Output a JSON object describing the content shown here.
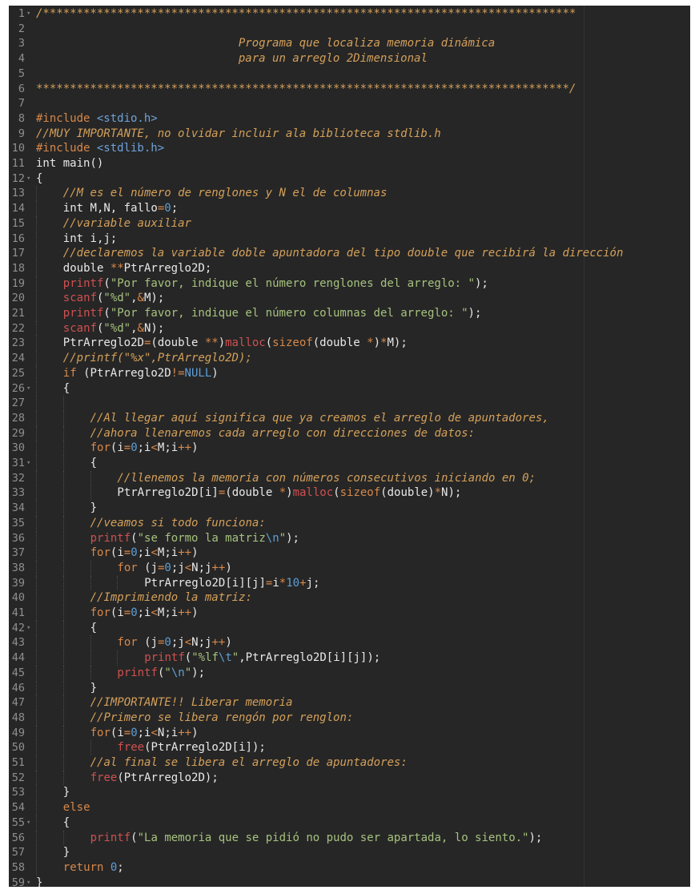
{
  "editor": {
    "line_height": 18.7,
    "char_width": 8.45,
    "colors": {
      "background": "#262626",
      "line_number": "#8f8f8f",
      "comment": "#d4a05a",
      "string": "#a6c27e",
      "keyword": "#d7884a",
      "function": "#cf5050",
      "number": "#5d9fd6",
      "text": "#e8e8e8"
    },
    "lines": [
      {
        "n": "1",
        "fold": true,
        "indent": 0,
        "tokens": [
          [
            "comment",
            "/*******************************************************************************"
          ]
        ]
      },
      {
        "n": "2",
        "fold": false,
        "indent": 0,
        "tokens": []
      },
      {
        "n": "3",
        "fold": false,
        "indent": 0,
        "tokens": [
          [
            "plain",
            "                              "
          ],
          [
            "comment",
            "Programa que localiza memoria dinámica"
          ]
        ]
      },
      {
        "n": "4",
        "fold": false,
        "indent": 0,
        "tokens": [
          [
            "plain",
            "                              "
          ],
          [
            "comment",
            "para un arreglo 2Dimensional"
          ]
        ]
      },
      {
        "n": "5",
        "fold": false,
        "indent": 0,
        "tokens": []
      },
      {
        "n": "6",
        "fold": false,
        "indent": 0,
        "tokens": [
          [
            "comment",
            "*******************************************************************************/"
          ]
        ]
      },
      {
        "n": "7",
        "fold": false,
        "indent": 0,
        "tokens": []
      },
      {
        "n": "8",
        "fold": false,
        "indent": 0,
        "tokens": [
          [
            "include",
            "#include "
          ],
          [
            "header",
            "<stdio.h>"
          ]
        ]
      },
      {
        "n": "9",
        "fold": false,
        "indent": 0,
        "tokens": [
          [
            "comment",
            "//MUY IMPORTANTE, no olvidar incluir ala biblioteca stdlib.h"
          ]
        ]
      },
      {
        "n": "10",
        "fold": false,
        "indent": 0,
        "tokens": [
          [
            "include",
            "#include "
          ],
          [
            "header",
            "<stdlib.h>"
          ]
        ]
      },
      {
        "n": "11",
        "fold": false,
        "indent": 0,
        "tokens": [
          [
            "plain",
            "int main()"
          ]
        ]
      },
      {
        "n": "12",
        "fold": true,
        "indent": 0,
        "tokens": [
          [
            "plain",
            "{"
          ]
        ]
      },
      {
        "n": "13",
        "fold": false,
        "indent": 1,
        "tokens": [
          [
            "comment",
            "//M es el número de renglones y N el de columnas"
          ]
        ]
      },
      {
        "n": "14",
        "fold": false,
        "indent": 1,
        "tokens": [
          [
            "plain",
            "int M,N, fallo"
          ],
          [
            "operator",
            "="
          ],
          [
            "number",
            "0"
          ],
          [
            "plain",
            ";"
          ]
        ]
      },
      {
        "n": "15",
        "fold": false,
        "indent": 1,
        "tokens": [
          [
            "comment",
            "//variable auxiliar"
          ]
        ]
      },
      {
        "n": "16",
        "fold": false,
        "indent": 1,
        "tokens": [
          [
            "plain",
            "int i,j;"
          ]
        ]
      },
      {
        "n": "17",
        "fold": false,
        "indent": 1,
        "tokens": [
          [
            "comment",
            "//declaremos la variable doble apuntadora del tipo double que recibirá la dirección"
          ]
        ]
      },
      {
        "n": "18",
        "fold": false,
        "indent": 1,
        "tokens": [
          [
            "plain",
            "double "
          ],
          [
            "operator",
            "**"
          ],
          [
            "plain",
            "PtrArreglo2D;"
          ]
        ]
      },
      {
        "n": "19",
        "fold": false,
        "indent": 1,
        "tokens": [
          [
            "fn",
            "printf"
          ],
          [
            "plain",
            "("
          ],
          [
            "string",
            "\"Por favor, indique el número renglones del arreglo: \""
          ],
          [
            "plain",
            ");"
          ]
        ]
      },
      {
        "n": "20",
        "fold": false,
        "indent": 1,
        "tokens": [
          [
            "fn",
            "scanf"
          ],
          [
            "plain",
            "("
          ],
          [
            "string",
            "\"%d\""
          ],
          [
            "plain",
            ","
          ],
          [
            "operator",
            "&"
          ],
          [
            "plain",
            "M);"
          ]
        ]
      },
      {
        "n": "21",
        "fold": false,
        "indent": 1,
        "tokens": [
          [
            "fn",
            "printf"
          ],
          [
            "plain",
            "("
          ],
          [
            "string",
            "\"Por favor, indique el número columnas del arreglo: \""
          ],
          [
            "plain",
            ");"
          ]
        ]
      },
      {
        "n": "22",
        "fold": false,
        "indent": 1,
        "tokens": [
          [
            "fn",
            "scanf"
          ],
          [
            "plain",
            "("
          ],
          [
            "string",
            "\"%d\""
          ],
          [
            "plain",
            ","
          ],
          [
            "operator",
            "&"
          ],
          [
            "plain",
            "N);"
          ]
        ]
      },
      {
        "n": "23",
        "fold": false,
        "indent": 1,
        "tokens": [
          [
            "plain",
            "PtrArreglo2D"
          ],
          [
            "operator",
            "="
          ],
          [
            "plain",
            "(double "
          ],
          [
            "operator",
            "**"
          ],
          [
            "plain",
            ")"
          ],
          [
            "fn",
            "malloc"
          ],
          [
            "plain",
            "("
          ],
          [
            "keyword",
            "sizeof"
          ],
          [
            "plain",
            "(double "
          ],
          [
            "operator",
            "*"
          ],
          [
            "plain",
            ")"
          ],
          [
            "operator",
            "*"
          ],
          [
            "plain",
            "M);"
          ]
        ]
      },
      {
        "n": "24",
        "fold": false,
        "indent": 1,
        "tokens": [
          [
            "comment",
            "//printf(\"%x\",PtrArreglo2D);"
          ]
        ]
      },
      {
        "n": "25",
        "fold": false,
        "indent": 1,
        "tokens": [
          [
            "keyword",
            "if"
          ],
          [
            "plain",
            " (PtrArreglo2D"
          ],
          [
            "operator",
            "!="
          ],
          [
            "number",
            "NULL"
          ],
          [
            "plain",
            ")"
          ]
        ]
      },
      {
        "n": "26",
        "fold": true,
        "indent": 1,
        "tokens": [
          [
            "plain",
            "{"
          ]
        ]
      },
      {
        "n": "27",
        "fold": false,
        "indent": 2,
        "tokens": []
      },
      {
        "n": "28",
        "fold": false,
        "indent": 2,
        "tokens": [
          [
            "comment",
            "//Al llegar aquí significa que ya creamos el arreglo de apuntadores,"
          ]
        ]
      },
      {
        "n": "29",
        "fold": false,
        "indent": 2,
        "tokens": [
          [
            "comment",
            "//ahora llenaremos cada arreglo con direcciones de datos:"
          ]
        ]
      },
      {
        "n": "30",
        "fold": false,
        "indent": 2,
        "tokens": [
          [
            "keyword",
            "for"
          ],
          [
            "plain",
            "(i"
          ],
          [
            "operator",
            "="
          ],
          [
            "number",
            "0"
          ],
          [
            "plain",
            ";i"
          ],
          [
            "operator",
            "<"
          ],
          [
            "plain",
            "M;i"
          ],
          [
            "operator",
            "++"
          ],
          [
            "plain",
            ")"
          ]
        ]
      },
      {
        "n": "31",
        "fold": true,
        "indent": 2,
        "tokens": [
          [
            "plain",
            "{"
          ]
        ]
      },
      {
        "n": "32",
        "fold": false,
        "indent": 3,
        "tokens": [
          [
            "comment",
            "//llenemos la memoria con números consecutivos iniciando en 0;"
          ]
        ]
      },
      {
        "n": "33",
        "fold": false,
        "indent": 3,
        "tokens": [
          [
            "plain",
            "PtrArreglo2D[i]"
          ],
          [
            "operator",
            "="
          ],
          [
            "plain",
            "(double "
          ],
          [
            "operator",
            "*"
          ],
          [
            "plain",
            ")"
          ],
          [
            "fn",
            "malloc"
          ],
          [
            "plain",
            "("
          ],
          [
            "keyword",
            "sizeof"
          ],
          [
            "plain",
            "(double)"
          ],
          [
            "operator",
            "*"
          ],
          [
            "plain",
            "N);"
          ]
        ]
      },
      {
        "n": "34",
        "fold": false,
        "indent": 2,
        "tokens": [
          [
            "plain",
            "}"
          ]
        ]
      },
      {
        "n": "35",
        "fold": false,
        "indent": 2,
        "tokens": [
          [
            "comment",
            "//veamos si todo funciona:"
          ]
        ]
      },
      {
        "n": "36",
        "fold": false,
        "indent": 2,
        "tokens": [
          [
            "fn",
            "printf"
          ],
          [
            "plain",
            "("
          ],
          [
            "string",
            "\"se formo la matriz"
          ],
          [
            "escape",
            "\\n"
          ],
          [
            "string",
            "\""
          ],
          [
            "plain",
            ");"
          ]
        ]
      },
      {
        "n": "37",
        "fold": false,
        "indent": 2,
        "tokens": [
          [
            "keyword",
            "for"
          ],
          [
            "plain",
            "(i"
          ],
          [
            "operator",
            "="
          ],
          [
            "number",
            "0"
          ],
          [
            "plain",
            ";i"
          ],
          [
            "operator",
            "<"
          ],
          [
            "plain",
            "M;i"
          ],
          [
            "operator",
            "++"
          ],
          [
            "plain",
            ")"
          ]
        ]
      },
      {
        "n": "38",
        "fold": false,
        "indent": 3,
        "tokens": [
          [
            "keyword",
            "for"
          ],
          [
            "plain",
            " (j"
          ],
          [
            "operator",
            "="
          ],
          [
            "number",
            "0"
          ],
          [
            "plain",
            ";j"
          ],
          [
            "operator",
            "<"
          ],
          [
            "plain",
            "N;j"
          ],
          [
            "operator",
            "++"
          ],
          [
            "plain",
            ")"
          ]
        ]
      },
      {
        "n": "39",
        "fold": false,
        "indent": 4,
        "tokens": [
          [
            "plain",
            "PtrArreglo2D[i][j]"
          ],
          [
            "operator",
            "="
          ],
          [
            "plain",
            "i"
          ],
          [
            "operator",
            "*"
          ],
          [
            "number",
            "10"
          ],
          [
            "operator",
            "+"
          ],
          [
            "plain",
            "j;"
          ]
        ]
      },
      {
        "n": "40",
        "fold": false,
        "indent": 2,
        "tokens": [
          [
            "comment",
            "//Imprimiendo la matriz:"
          ]
        ]
      },
      {
        "n": "41",
        "fold": false,
        "indent": 2,
        "tokens": [
          [
            "keyword",
            "for"
          ],
          [
            "plain",
            "(i"
          ],
          [
            "operator",
            "="
          ],
          [
            "number",
            "0"
          ],
          [
            "plain",
            ";i"
          ],
          [
            "operator",
            "<"
          ],
          [
            "plain",
            "M;i"
          ],
          [
            "operator",
            "++"
          ],
          [
            "plain",
            ")"
          ]
        ]
      },
      {
        "n": "42",
        "fold": true,
        "indent": 2,
        "tokens": [
          [
            "plain",
            "{"
          ]
        ]
      },
      {
        "n": "43",
        "fold": false,
        "indent": 3,
        "tokens": [
          [
            "keyword",
            "for"
          ],
          [
            "plain",
            " (j"
          ],
          [
            "operator",
            "="
          ],
          [
            "number",
            "0"
          ],
          [
            "plain",
            ";j"
          ],
          [
            "operator",
            "<"
          ],
          [
            "plain",
            "N;j"
          ],
          [
            "operator",
            "++"
          ],
          [
            "plain",
            ")"
          ]
        ]
      },
      {
        "n": "44",
        "fold": false,
        "indent": 4,
        "tokens": [
          [
            "fn",
            "printf"
          ],
          [
            "plain",
            "("
          ],
          [
            "string",
            "\"%lf"
          ],
          [
            "escape",
            "\\t"
          ],
          [
            "string",
            "\""
          ],
          [
            "plain",
            ",PtrArreglo2D[i][j]);"
          ]
        ]
      },
      {
        "n": "45",
        "fold": false,
        "indent": 3,
        "tokens": [
          [
            "fn",
            "printf"
          ],
          [
            "plain",
            "("
          ],
          [
            "string",
            "\""
          ],
          [
            "escape",
            "\\n"
          ],
          [
            "string",
            "\""
          ],
          [
            "plain",
            ");"
          ]
        ]
      },
      {
        "n": "46",
        "fold": false,
        "indent": 2,
        "tokens": [
          [
            "plain",
            "}"
          ]
        ]
      },
      {
        "n": "47",
        "fold": false,
        "indent": 2,
        "tokens": [
          [
            "comment",
            "//IMPORTANTE!! Liberar memoria"
          ]
        ]
      },
      {
        "n": "48",
        "fold": false,
        "indent": 2,
        "tokens": [
          [
            "comment",
            "//Primero se libera rengón por renglon:"
          ]
        ]
      },
      {
        "n": "49",
        "fold": false,
        "indent": 2,
        "tokens": [
          [
            "keyword",
            "for"
          ],
          [
            "plain",
            "(i"
          ],
          [
            "operator",
            "="
          ],
          [
            "number",
            "0"
          ],
          [
            "plain",
            ";i"
          ],
          [
            "operator",
            "<"
          ],
          [
            "plain",
            "N;i"
          ],
          [
            "operator",
            "++"
          ],
          [
            "plain",
            ")"
          ]
        ]
      },
      {
        "n": "50",
        "fold": false,
        "indent": 3,
        "tokens": [
          [
            "fn",
            "free"
          ],
          [
            "plain",
            "(PtrArreglo2D[i]);"
          ]
        ]
      },
      {
        "n": "51",
        "fold": false,
        "indent": 2,
        "tokens": [
          [
            "comment",
            "//al final se libera el arreglo de apuntadores:"
          ]
        ]
      },
      {
        "n": "52",
        "fold": false,
        "indent": 2,
        "tokens": [
          [
            "fn",
            "free"
          ],
          [
            "plain",
            "(PtrArreglo2D);"
          ]
        ]
      },
      {
        "n": "53",
        "fold": false,
        "indent": 1,
        "tokens": [
          [
            "plain",
            "}"
          ]
        ]
      },
      {
        "n": "54",
        "fold": false,
        "indent": 1,
        "tokens": [
          [
            "keyword",
            "else"
          ]
        ]
      },
      {
        "n": "55",
        "fold": true,
        "indent": 1,
        "tokens": [
          [
            "plain",
            "{"
          ]
        ]
      },
      {
        "n": "56",
        "fold": false,
        "indent": 2,
        "tokens": [
          [
            "fn",
            "printf"
          ],
          [
            "plain",
            "("
          ],
          [
            "string",
            "\"La memoria que se pidió no pudo ser apartada, lo siento.\""
          ],
          [
            "plain",
            ");"
          ]
        ]
      },
      {
        "n": "57",
        "fold": false,
        "indent": 1,
        "tokens": [
          [
            "plain",
            "}"
          ]
        ]
      },
      {
        "n": "58",
        "fold": false,
        "indent": 1,
        "tokens": [
          [
            "keyword",
            "return"
          ],
          [
            "plain",
            " "
          ],
          [
            "number",
            "0"
          ],
          [
            "plain",
            ";"
          ]
        ]
      },
      {
        "n": "59",
        "fold": true,
        "indent": 0,
        "tokens": [
          [
            "plain",
            "}"
          ]
        ]
      }
    ]
  }
}
